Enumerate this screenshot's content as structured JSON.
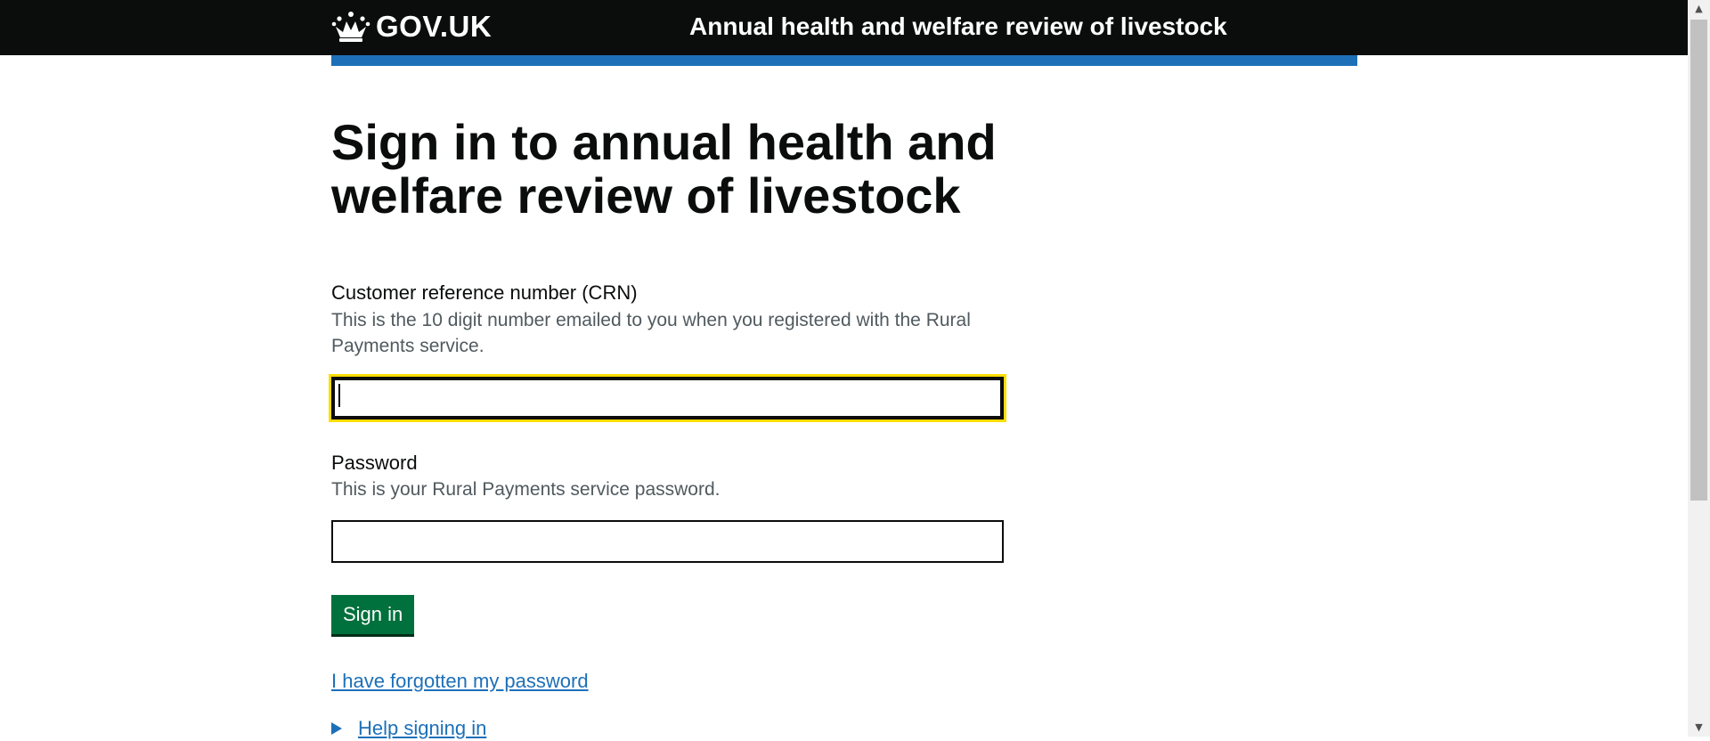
{
  "header": {
    "logo_text": "GOV.UK",
    "service_name": "Annual health and welfare review of livestock",
    "logo_icon": "crown-icon"
  },
  "page": {
    "title": "Sign in to annual health and welfare review of livestock"
  },
  "form": {
    "crn": {
      "label": "Customer reference number (CRN)",
      "hint": "This is the 10 digit number emailed to you when you registered with the Rural Payments service.",
      "value": ""
    },
    "password": {
      "label": "Password",
      "hint": "This is your Rural Payments service password.",
      "value": ""
    },
    "submit_label": "Sign in",
    "forgot_link": "I have forgotten my password",
    "help_details": "Help signing in"
  },
  "colors": {
    "header_bg": "#0b0c0c",
    "accent_blue": "#1d70b8",
    "button_green": "#00703c",
    "focus_yellow": "#ffdd00"
  }
}
